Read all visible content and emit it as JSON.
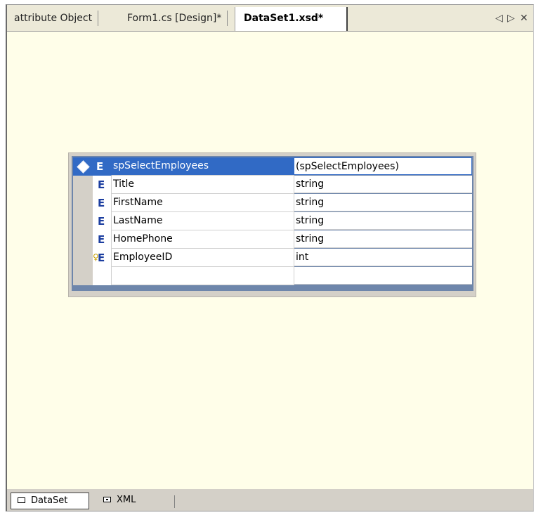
{
  "tabs": [
    {
      "label": "attribute Object",
      "active": false
    },
    {
      "label": "Form1.cs [Design]*",
      "active": false
    },
    {
      "label": "DataSet1.xsd*",
      "active": true
    }
  ],
  "tab_controls": {
    "prev": "◁",
    "next": "▷",
    "close": "✕"
  },
  "element_table": {
    "header": {
      "icon": "E",
      "name": "spSelectEmployees",
      "type": "(spSelectEmployees)"
    },
    "rows": [
      {
        "icon": "E",
        "name": "Title",
        "type": "string",
        "key": false
      },
      {
        "icon": "E",
        "name": "FirstName",
        "type": "string",
        "key": false
      },
      {
        "icon": "E",
        "name": "LastName",
        "type": "string",
        "key": false
      },
      {
        "icon": "E",
        "name": "HomePhone",
        "type": "string",
        "key": false
      },
      {
        "icon": "E",
        "name": "EmployeeID",
        "type": "int",
        "key": true,
        "key_glyph": "♀"
      },
      {
        "icon": "",
        "name": "",
        "type": "",
        "key": false
      }
    ]
  },
  "view_buttons": [
    {
      "label": "DataSet",
      "active": true,
      "icon": "dataset-view-icon"
    },
    {
      "label": "XML",
      "active": false,
      "icon": "xml-view-icon"
    }
  ],
  "colors": {
    "design_surface": "#fffee9",
    "selection": "#316ac5",
    "element_icon": "#1c3ea0"
  }
}
